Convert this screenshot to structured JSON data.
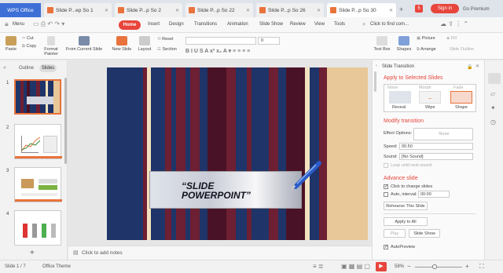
{
  "titlebar": {
    "wps_label": "WPS Office",
    "tabs": [
      {
        "label": "Slide P...ep So 1",
        "color": "#e8733c"
      },
      {
        "label": "Slide P...p So 2",
        "color": "#e8733c"
      },
      {
        "label": "Slide P...p So 22",
        "color": "#e8733c"
      },
      {
        "label": "Slide P...p So 26",
        "color": "#e8733c"
      },
      {
        "label": "Slide P...p So 30",
        "color": "#e8733c"
      }
    ],
    "badge": "5",
    "signin": "Sign in",
    "premium": "Go Premium"
  },
  "menubar": {
    "menu": "Menu",
    "items": [
      "Home",
      "Insert",
      "Design",
      "Transitions",
      "Animation",
      "Slide Show",
      "Review",
      "View",
      "Tools"
    ],
    "search": "Click to find com..."
  },
  "ribbon": {
    "paste": "Paste",
    "cut": "Cut",
    "copy": "Copy",
    "format_painter": "Format Painter",
    "from_current": "From Current Slide",
    "new_slide": "New Slide",
    "layout": "Layout",
    "reset": "Reset",
    "section": "Section",
    "font_size": "0",
    "text_box": "Text Box",
    "shapes": "Shapes",
    "picture": "Picture",
    "fill": "Fill",
    "arrange": "Arrange",
    "outline": "Slide Outline"
  },
  "left": {
    "tab_outline": "Outline",
    "tab_slides": "Slides",
    "thumbs": [
      "1",
      "2",
      "3",
      "4"
    ],
    "add": "+"
  },
  "slide": {
    "title_line1": "“SLIDE",
    "title_line2": "POWERPOINT”"
  },
  "notes": {
    "placeholder": "Click to add notes"
  },
  "pane": {
    "header": "Slide Transition",
    "apply_title": "Apply to Selected Slides",
    "effects": [
      "Reveal",
      "Wipe",
      "Shape"
    ],
    "effects_top": [
      "None",
      "Morph",
      "Fade"
    ],
    "modify_title": "Modify transition",
    "effect_options": "Effect Options:",
    "effect_value": "None",
    "speed_label": "Speed:",
    "speed_value": "00.50",
    "sound_label": "Sound:",
    "sound_value": "[No Sound]",
    "loop_label": "Loop until next sound",
    "advance_title": "Advance slide",
    "click_label": "Click to change slides",
    "auto_label": "Auto, interval:",
    "auto_value": "00:00",
    "rehearse": "Rehearse This Slide",
    "apply_all": "Apply to All",
    "play": "Play",
    "slideshow": "Slide Show",
    "autopreview": "AutoPreview"
  },
  "status": {
    "slide_count": "Slide 1 / 7",
    "theme": "Office Theme",
    "zoom": "58%"
  },
  "colors": {
    "accent": "#e8453c",
    "wps_blue": "#3d6fd6",
    "stripe_navy": "#1f3468",
    "stripe_maroon": "#6d1f33",
    "stripe_wine": "#4a1226",
    "stripe_tan": "#e8c898",
    "stripe_cream": "#f3e2bf"
  }
}
